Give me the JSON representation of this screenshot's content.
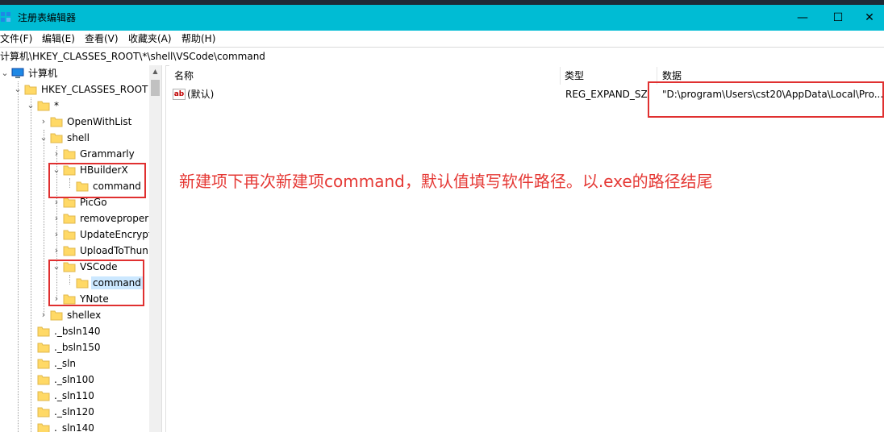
{
  "window": {
    "title": "注册表编辑器",
    "controls": {
      "minimize": "—",
      "maximize": "☐",
      "close": "✕"
    }
  },
  "menu": [
    "文件(F)",
    "编辑(E)",
    "查看(V)",
    "收藏夹(A)",
    "帮助(H)"
  ],
  "address": "计算机\\HKEY_CLASSES_ROOT\\*\\shell\\VSCode\\command",
  "tree": {
    "root": "计算机",
    "hive": "HKEY_CLASSES_ROOT",
    "star": "*",
    "openwithlist": "OpenWithList",
    "shell": "shell",
    "grammarly": "Grammarly",
    "hbuilderx": "HBuilderX",
    "hbuilderx_command": "command",
    "picgo": "PicGo",
    "removeproper": "removeproper",
    "updateencrypt": "UpdateEncrypt",
    "uploadtothun": "UploadToThun",
    "vscode": "VSCode",
    "vscode_command": "command",
    "ynote": "YNote",
    "shellex": "shellex",
    "bsln140": "._bsln140",
    "bsln150": "._bsln150",
    "sln": "._sln",
    "sln100": "._sln100",
    "sln110": "._sln110",
    "sln120": "._sln120",
    "sln140": "._sln140"
  },
  "columns": {
    "name": "名称",
    "type": "类型",
    "data": "数据"
  },
  "values": [
    {
      "name": "(默认)",
      "type": "REG_EXPAND_SZ",
      "data": "\"D:\\program\\Users\\cst20\\AppData\\Local\\Pro..."
    }
  ],
  "annotation": "新建项下再次新建项command，默认值填写软件路径。以.exe的路径结尾",
  "colors": {
    "titlebar": "#00bcd4",
    "highlight": "#e03030",
    "selection": "#cce8ff",
    "folder": "#ffd966"
  }
}
